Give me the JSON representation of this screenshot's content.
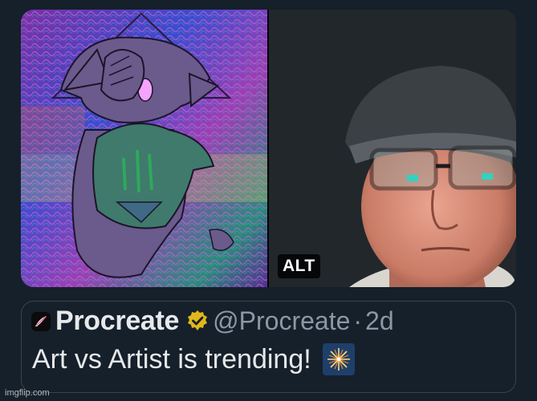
{
  "media": {
    "left_image_icon": "sketch-character-artwork",
    "right_image_icon": "man-selfie-photo",
    "alt_label": "ALT"
  },
  "quote": {
    "author_name": "Procreate",
    "handle": "@Procreate",
    "separator": "·",
    "time": "2d",
    "text": "Art vs Artist is trending!",
    "emoji_icon": "fireworks-emoji"
  },
  "watermark": "imgflip.com",
  "colors": {
    "background": "#15202b",
    "primary_text": "#e7e9ea",
    "secondary_text": "#8b98a5",
    "border": "#38444d",
    "verified_gold": "#e2b719"
  }
}
